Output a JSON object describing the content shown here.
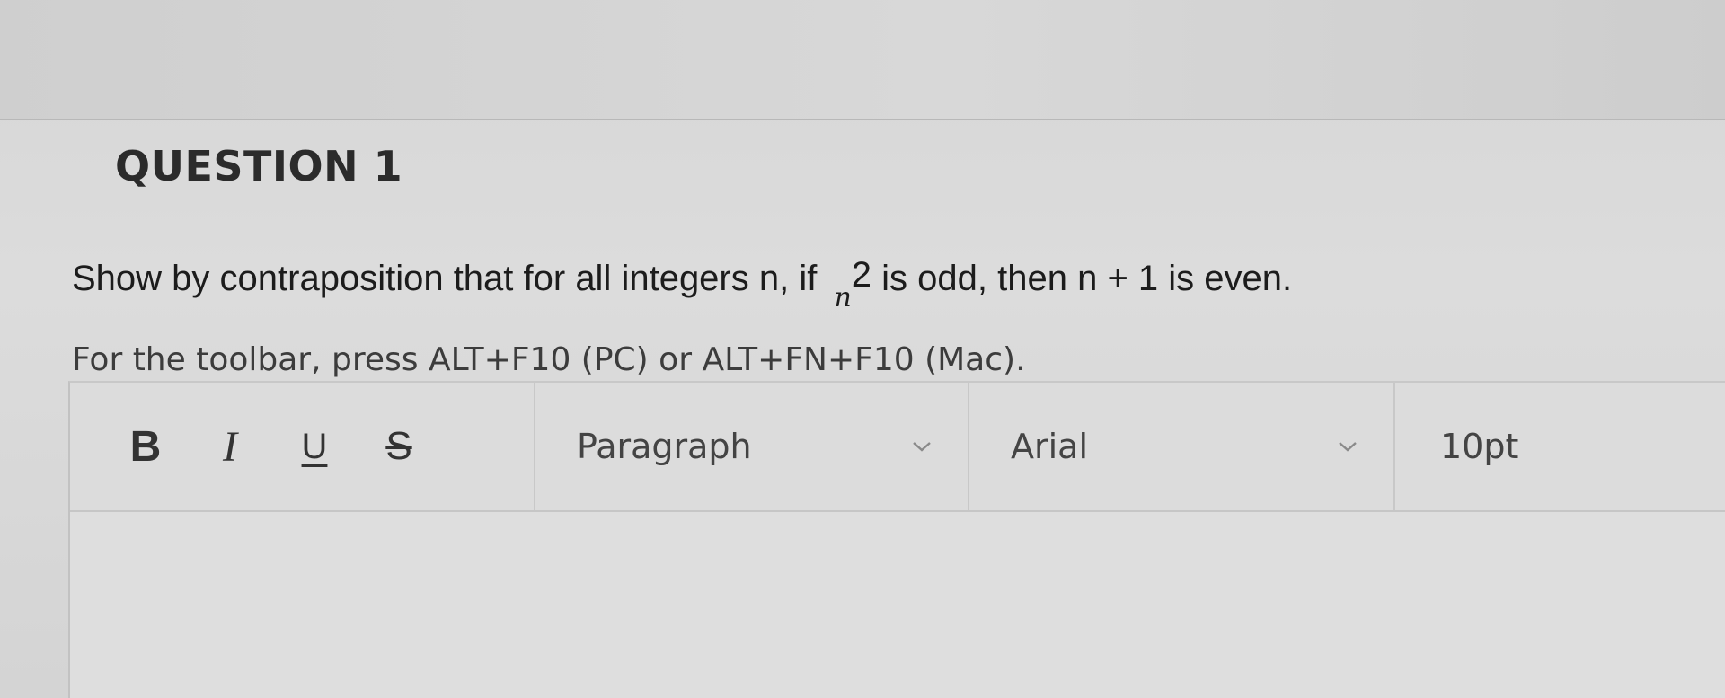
{
  "question": {
    "title": "QUESTION 1",
    "prompt_before": "Show by contraposition that for all integers n, if",
    "prompt_base": "n",
    "prompt_exponent": "2",
    "prompt_after": "is odd, then n + 1 is even."
  },
  "toolbar_hint": "For the toolbar, press ALT+F10 (PC) or ALT+FN+F10 (Mac).",
  "toolbar": {
    "bold_label": "B",
    "italic_label": "I",
    "underline_label": "U",
    "strikethrough_label": "S",
    "block_format": "Paragraph",
    "font_family": "Arial",
    "font_size": "10pt"
  },
  "icons": {
    "bold": "bold-icon",
    "italic": "italic-icon",
    "underline": "underline-icon",
    "strikethrough": "strikethrough-icon",
    "dropdown": "chevron-down-icon"
  }
}
